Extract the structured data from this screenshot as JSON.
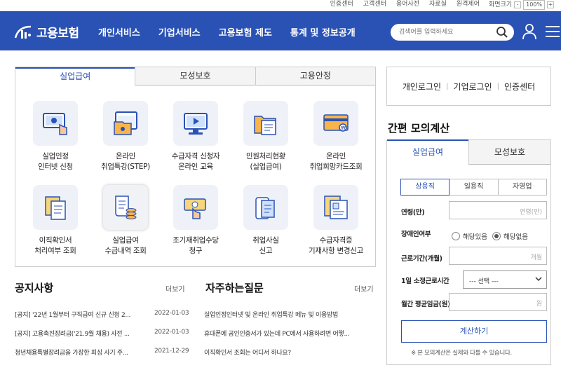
{
  "utility": {
    "links": [
      "인증센터",
      "고객센터",
      "용어사전",
      "자료실",
      "원격제어"
    ],
    "zoom_label": "화면크기",
    "zoom_minus": "-",
    "zoom_value": "100%",
    "zoom_plus": "+"
  },
  "header": {
    "logo_text": "고용보험",
    "nav": [
      "개인서비스",
      "기업서비스",
      "고용보험 제도",
      "통계 및 정보공개"
    ],
    "search_placeholder": "검색어를 입력하세요",
    "brand_color": "#2a52b5"
  },
  "service_panel": {
    "tabs": [
      "실업급여",
      "모성보호",
      "고용안정"
    ],
    "active_tab": "실업급여",
    "items": [
      {
        "label": "실업인정\n인터넷 신청",
        "icon": "monitor-hand-icon"
      },
      {
        "label": "온라인\n취업특강(STEP)",
        "icon": "online-lecture-icon"
      },
      {
        "label": "수급자격 신청자\n온라인 교육",
        "icon": "video-education-icon"
      },
      {
        "label": "민원처리현황\n(실업급여)",
        "icon": "folder-document-icon"
      },
      {
        "label": "온라인\n취업희망카드조회",
        "icon": "card-icon"
      },
      {
        "label": "이직확인서\n처리여부 조회",
        "icon": "documents-icon"
      },
      {
        "label": "실업급여\n수급내역 조회",
        "icon": "scroll-coins-icon"
      },
      {
        "label": "조기재취업수당\n청구",
        "icon": "money-hand-icon"
      },
      {
        "label": "취업사실\n신고",
        "icon": "mobile-document-icon"
      },
      {
        "label": "수급자격증\n기재사항 변경신고",
        "icon": "certificate-icon"
      }
    ]
  },
  "notices": {
    "title": "공지사항",
    "more": "더보기",
    "items": [
      {
        "text": "[공지] '22년 1월부터 구직급여 신규 신청 2...",
        "date": "2022-01-03"
      },
      {
        "text": "[공지] 고용촉진장려금('21.9월 채용) 사전 ...",
        "date": "2022-01-03"
      },
      {
        "text": "청년채용특별장려금을 가장한 피싱 사기 주...",
        "date": "2021-12-29"
      }
    ]
  },
  "faq": {
    "title": "자주하는질문",
    "more": "더보기",
    "items": [
      "실업인정인터넷 및 온라인 취업특강 메뉴 및 이용방법",
      "휴대폰에 공인인증서가 있는데 PC에서 사용하려면 어떻...",
      "이직확인서 조회는 어디서 하나요?"
    ]
  },
  "login": {
    "items": [
      "개인로그인",
      "기업로그인",
      "인증센터"
    ],
    "separator": "|"
  },
  "calculator": {
    "title": "간편 모의계산",
    "tabs": [
      "실업급여",
      "모성보호"
    ],
    "active_tab": "실업급여",
    "employment_types": [
      "상용직",
      "일용직",
      "자영업"
    ],
    "active_type": "상용직",
    "age_label": "연령(만)",
    "age_placeholder": "연령(만)",
    "disability_label": "장애인여부",
    "disability_options": [
      "해당있음",
      "해당없음"
    ],
    "disability_selected": "해당없음",
    "period_label": "근로기간(개월)",
    "period_placeholder": "개월",
    "hours_label": "1일 소정근로시간",
    "hours_select": "--- 선택 ---",
    "wage_label": "월간 평균임금(원)",
    "wage_placeholder": "원",
    "button": "계산하기",
    "note": "※ 본 모의계산은 실제와 다를 수 있습니다."
  }
}
